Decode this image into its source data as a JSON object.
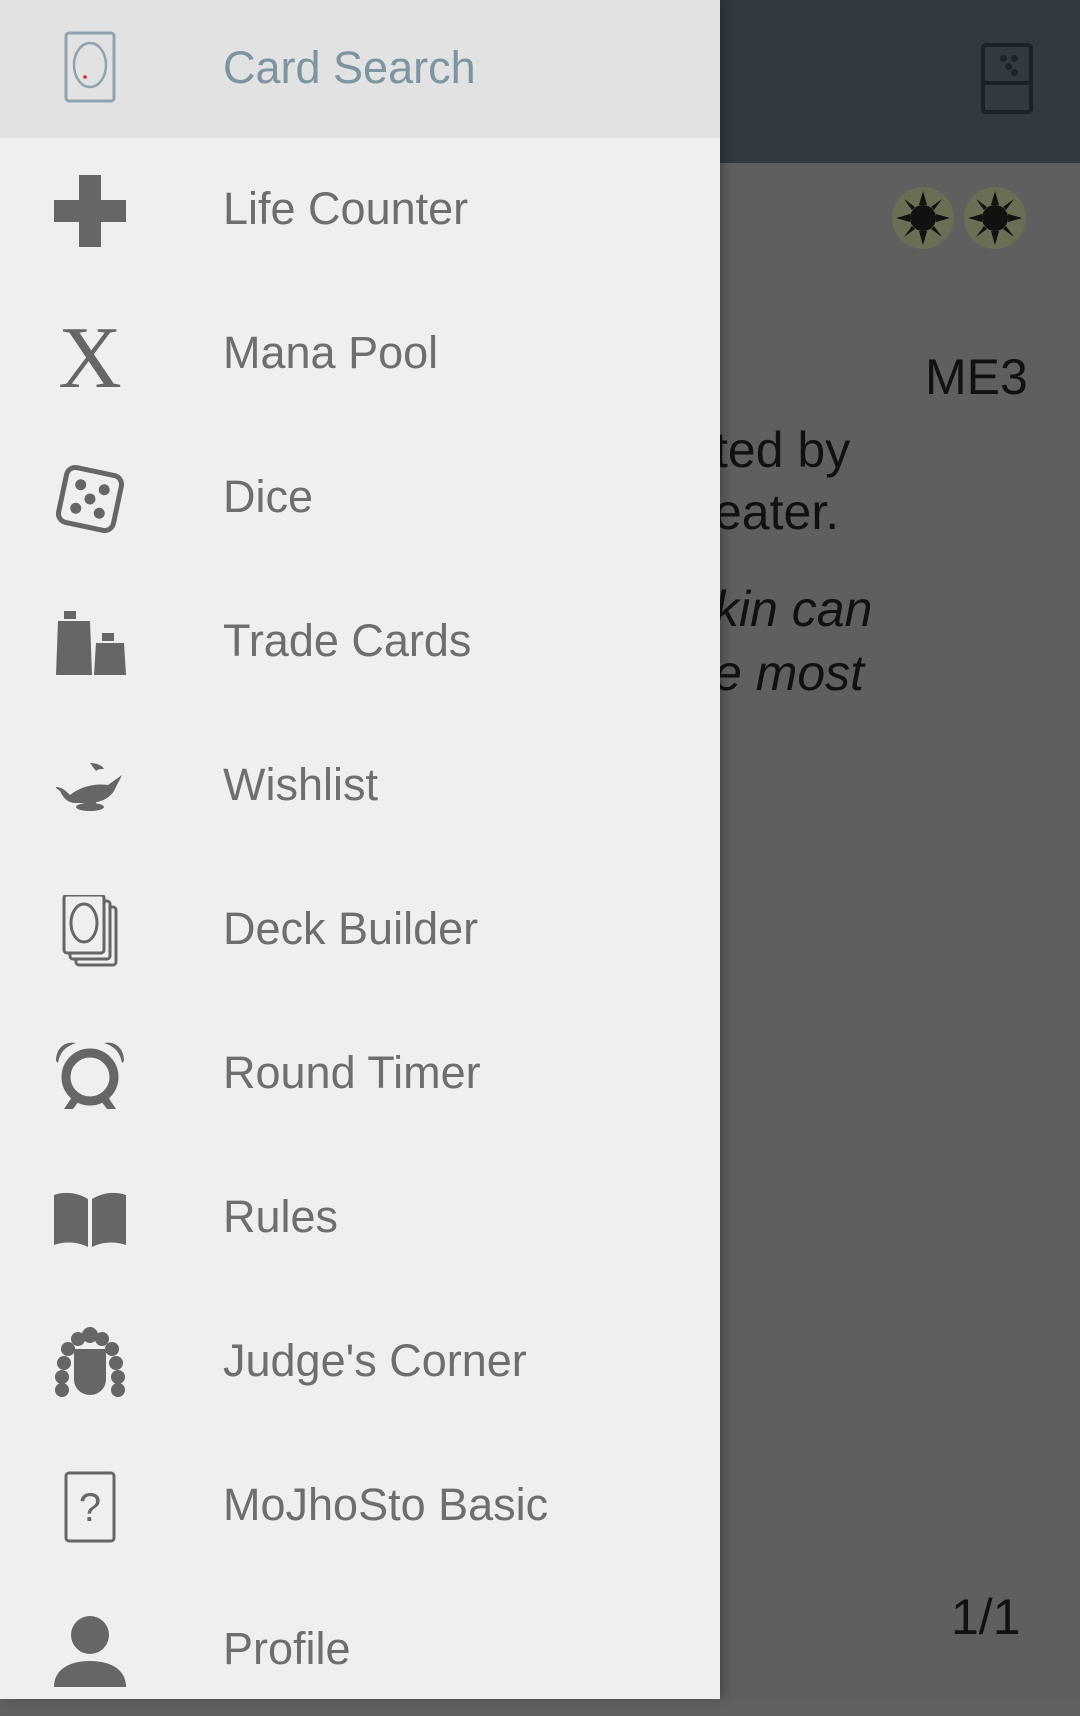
{
  "background": {
    "set_code": "ME3",
    "text_lines": [
      "ted by",
      "eater."
    ],
    "flavor_lines": [
      "kin can",
      "e most"
    ],
    "page_indicator": "1/1",
    "mana_icons": [
      "white-mana-icon",
      "white-mana-icon"
    ],
    "action_icon": "dice-phone-icon"
  },
  "drawer": {
    "items": [
      {
        "label": "Card Search",
        "icon": "card-search-icon",
        "active": true
      },
      {
        "label": "Life Counter",
        "icon": "plus-icon"
      },
      {
        "label": "Mana Pool",
        "icon": "mana-pool-icon"
      },
      {
        "label": "Dice",
        "icon": "dice-icon"
      },
      {
        "label": "Trade Cards",
        "icon": "scale-weights-icon"
      },
      {
        "label": "Wishlist",
        "icon": "magic-lamp-icon"
      },
      {
        "label": "Deck Builder",
        "icon": "card-stack-icon"
      },
      {
        "label": "Round Timer",
        "icon": "alarm-clock-icon"
      },
      {
        "label": "Rules",
        "icon": "book-icon"
      },
      {
        "label": "Judge's Corner",
        "icon": "judge-wig-icon"
      },
      {
        "label": "MoJhoSto Basic",
        "icon": "question-card-icon"
      },
      {
        "label": "Profile",
        "icon": "person-icon"
      }
    ]
  },
  "colors": {
    "drawer_bg": "#efefef",
    "active_item_bg": "#e2e2e2",
    "active_label": "#7d95a1",
    "label": "#6e6e6e",
    "app_bar": "#303a40"
  }
}
